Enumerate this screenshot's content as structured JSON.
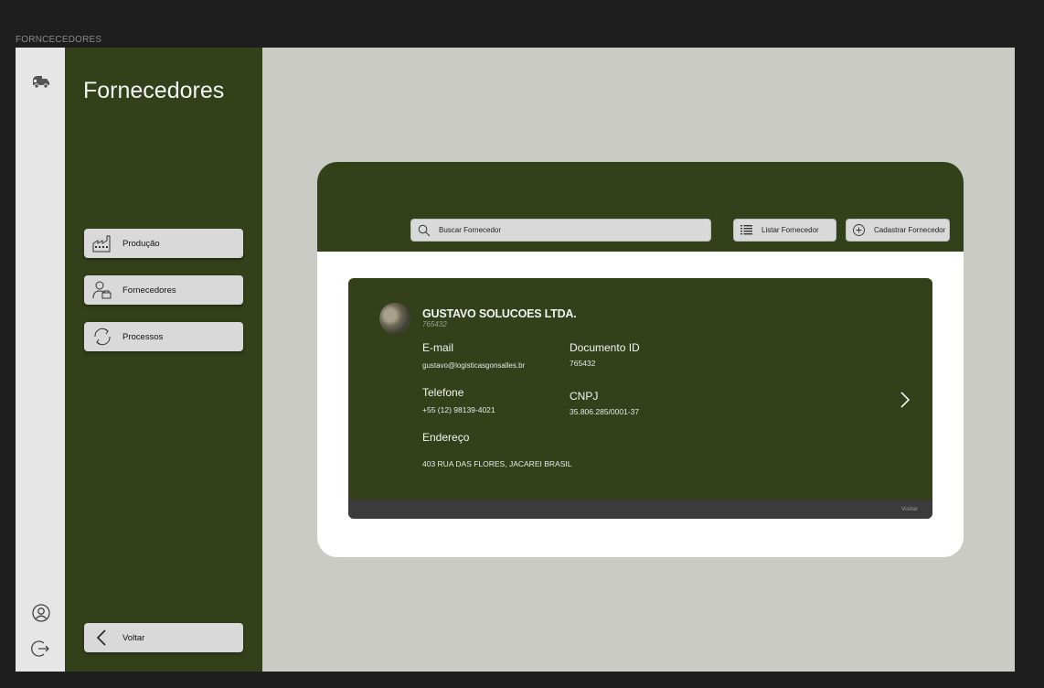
{
  "frame": {
    "label": "FORNCECEDORES"
  },
  "rail": {
    "icons": [
      "truck-icon",
      "user-circle-icon",
      "logout-icon"
    ]
  },
  "sidebar": {
    "title": "Fornecedores",
    "items": [
      {
        "label": "Produção",
        "icon": "factory-icon"
      },
      {
        "label": "Fornecedores",
        "icon": "supplier-icon"
      },
      {
        "label": "Processos",
        "icon": "refresh-icon"
      }
    ],
    "back_label": "Voltar"
  },
  "header": {
    "search_placeholder": "Buscar Fornecedor",
    "list_label": "Listar Fornecedor",
    "register_label": "Cadastrar Fornecedor"
  },
  "supplier": {
    "name": "GUSTAVO SOLUCOES LTDA.",
    "id": "765432",
    "email_label": "E-mail",
    "email": "gustavo@logisticasgonsalles.br",
    "doc_label": "Documento ID",
    "doc": "765432",
    "phone_label": "Telefone",
    "phone": "+55 (12) 98139-4021",
    "cnpj_label": "CNPJ",
    "cnpj": "35.806.285/0001-37",
    "address_label": "Endereço",
    "address": "403 RUA DAS FLORES, JACAREI BRASIL",
    "visit_label": "Visitar"
  },
  "colors": {
    "sidebar_bg": "#33401a",
    "canvas_bg": "#c9cbc4",
    "rail_bg": "#e6e6e6",
    "button_bg": "#d9d9d9"
  }
}
